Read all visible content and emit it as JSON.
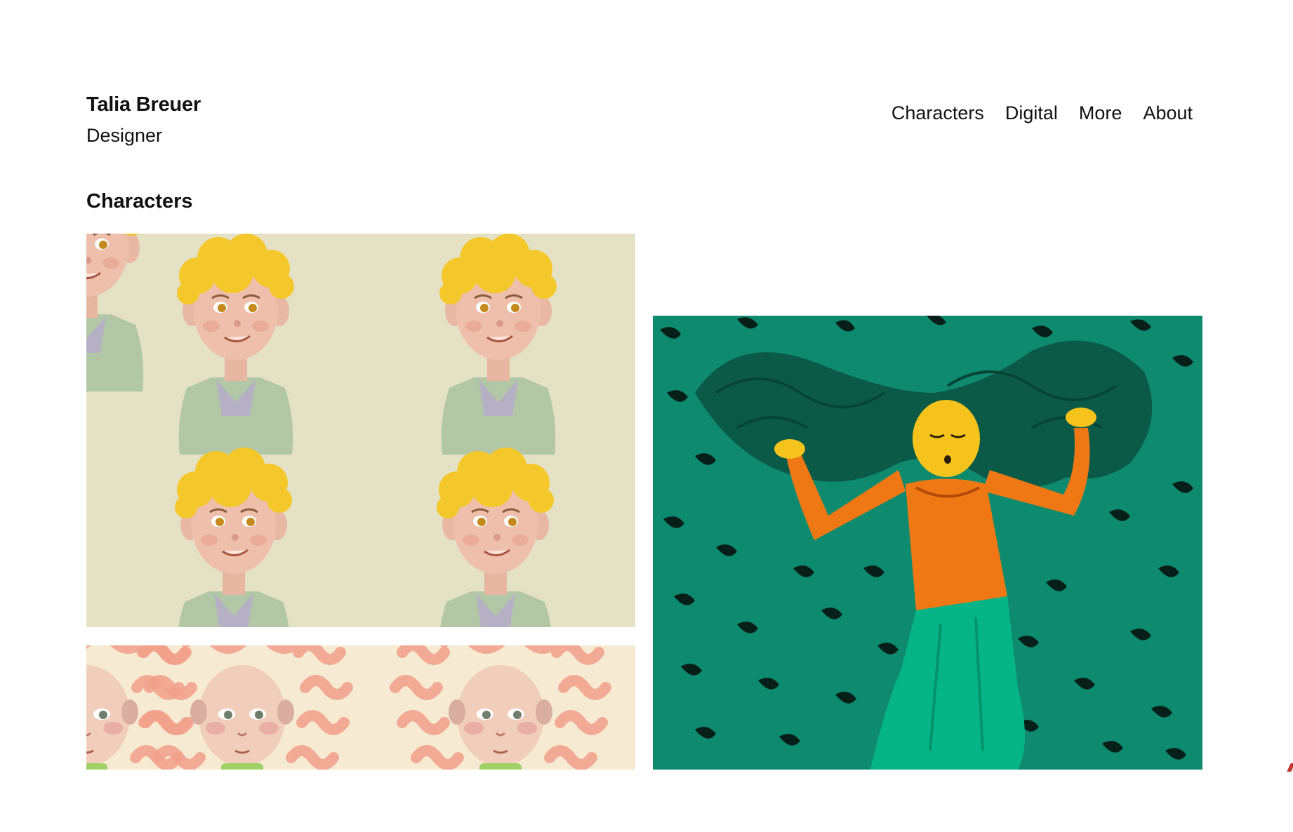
{
  "site": {
    "name": "Talia Breuer",
    "role": "Designer"
  },
  "nav": {
    "items": [
      {
        "label": "Characters"
      },
      {
        "label": "Digital"
      },
      {
        "label": "More"
      },
      {
        "label": "About"
      }
    ]
  },
  "section": {
    "title": "Characters"
  },
  "gallery": {
    "items": [
      {
        "subject": "four sketches of a blond boy with curly hair and green plaid shirt",
        "background": "#e5e1c5"
      },
      {
        "subject": "sketches of a girl with curly red hair",
        "background": "#f6ead2"
      },
      {
        "subject": "woman with long green hair in orange blouse and teal skirt on spotted green background",
        "background": "#0e8a6e"
      }
    ]
  },
  "colors": {
    "text": "#111111",
    "background": "#ffffff",
    "accent": "#c0362c"
  }
}
